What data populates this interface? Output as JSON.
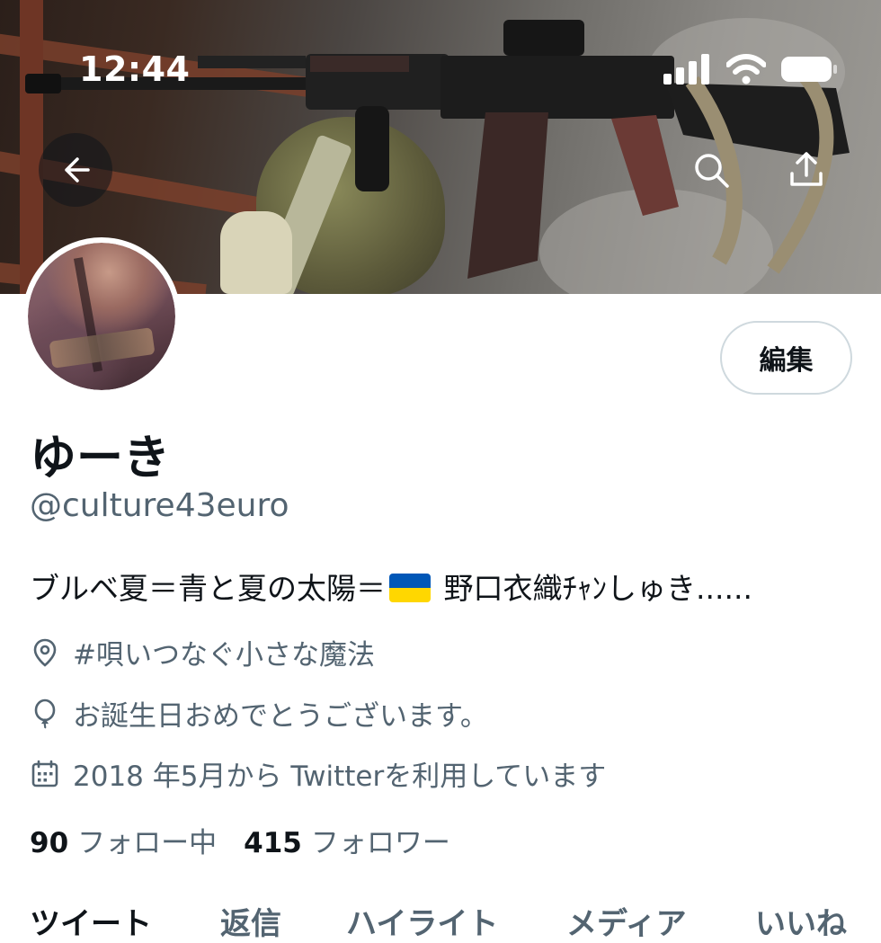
{
  "status_bar": {
    "time": "12:44"
  },
  "profile": {
    "display_name": "ゆーき",
    "handle": "@culture43euro",
    "bio_before_flag": "ブルベ夏＝青と夏の太陽＝",
    "bio_after_flag": " 野口衣織ﾁｬﾝしゅき......",
    "location": "#唄いつなぐ小さな魔法",
    "birthday": "お誕生日おめでとうございます。",
    "joined": "2018 年5月から Twitterを利用しています",
    "following_count": "90",
    "following_label": "フォロー中",
    "followers_count": "415",
    "followers_label": "フォロワー"
  },
  "actions": {
    "edit_label": "編集"
  },
  "tabs": [
    {
      "label": "ツイート"
    },
    {
      "label": "返信"
    },
    {
      "label": "ハイライト"
    },
    {
      "label": "メディア"
    },
    {
      "label": "いいね"
    }
  ],
  "colors": {
    "text_primary": "#0f1419",
    "text_secondary": "#536471",
    "border": "#cfd9de",
    "flag_blue": "#0057b7",
    "flag_yellow": "#ffd700"
  },
  "icons": {
    "back": "arrow-left-icon",
    "search": "search-icon",
    "share": "share-icon",
    "location": "location-pin-icon",
    "birthday": "balloon-icon",
    "joined": "calendar-icon"
  }
}
